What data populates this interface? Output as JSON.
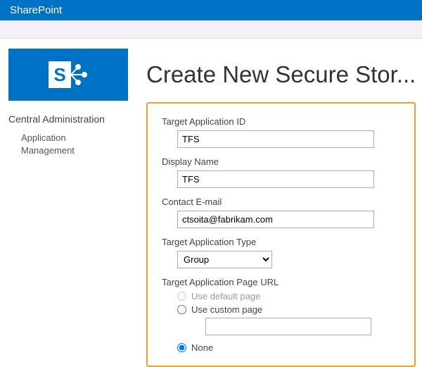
{
  "topbar": {
    "brand": "SharePoint"
  },
  "logo": {
    "letter": "S"
  },
  "nav": {
    "top": "Central Administration",
    "sub": "Application Management"
  },
  "page": {
    "title": "Create New Secure Stor..."
  },
  "form": {
    "target_app_id": {
      "label": "Target Application ID",
      "value": "TFS"
    },
    "display_name": {
      "label": "Display Name",
      "value": "TFS"
    },
    "contact_email": {
      "label": "Contact E-mail",
      "value": "ctsoita@fabrikam.com"
    },
    "app_type": {
      "label": "Target Application Type",
      "value": "Group",
      "options": [
        "Group"
      ]
    },
    "page_url": {
      "label": "Target Application Page URL",
      "opt_default": "Use default page",
      "opt_custom": "Use custom page",
      "opt_none": "None",
      "custom_value": "",
      "selected": "none"
    }
  }
}
